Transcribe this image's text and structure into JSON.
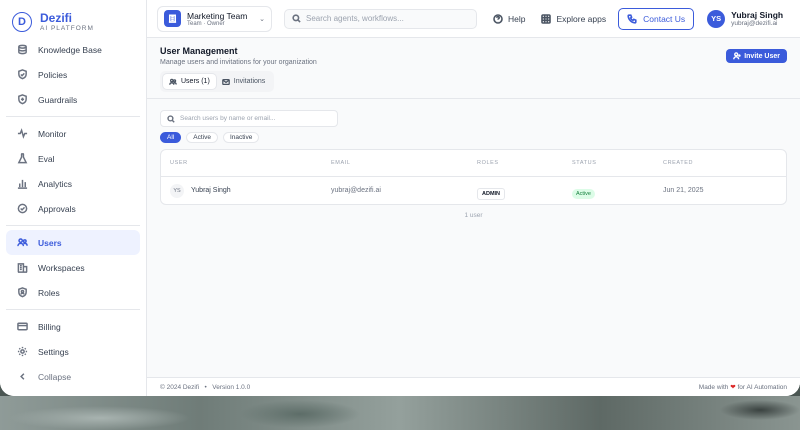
{
  "brand": {
    "name": "Dezifi",
    "subtitle": "AI PLATFORM",
    "logo_letter": "D"
  },
  "sidebar": {
    "items": [
      {
        "label": "Knowledge Base",
        "icon": "database-icon"
      },
      {
        "label": "Policies",
        "icon": "shield-check-icon"
      },
      {
        "label": "Guardrails",
        "icon": "shield-plus-icon"
      },
      {
        "label": "Monitor",
        "icon": "activity-icon"
      },
      {
        "label": "Eval",
        "icon": "flask-icon"
      },
      {
        "label": "Analytics",
        "icon": "bar-chart-icon"
      },
      {
        "label": "Approvals",
        "icon": "check-circle-icon"
      },
      {
        "label": "Users",
        "icon": "users-icon",
        "active": true
      },
      {
        "label": "Workspaces",
        "icon": "building-icon"
      },
      {
        "label": "Roles",
        "icon": "badge-icon"
      },
      {
        "label": "Billing",
        "icon": "credit-card-icon"
      },
      {
        "label": "Settings",
        "icon": "gear-icon"
      }
    ],
    "collapse_label": "Collapse"
  },
  "topbar": {
    "team_name": "Marketing Team",
    "team_role": "Team · Owner",
    "search_placeholder": "Search agents, workflows...",
    "help_label": "Help",
    "explore_label": "Explore apps",
    "contact_label": "Contact Us",
    "user_initials": "YS",
    "user_name": "Yubraj Singh",
    "user_email": "yubraj@dezifi.ai"
  },
  "page": {
    "title": "User Management",
    "subtitle": "Manage users and invitations for your organization",
    "invite_label": "Invite User",
    "tabs": [
      {
        "label": "Users (1)",
        "active": true
      },
      {
        "label": "Invitations"
      }
    ],
    "search_placeholder": "Search users by name or email...",
    "filters": [
      {
        "label": "All",
        "active": true
      },
      {
        "label": "Active"
      },
      {
        "label": "Inactive"
      }
    ],
    "columns": [
      "USER",
      "EMAIL",
      "ROLES",
      "STATUS",
      "CREATED"
    ],
    "rows": [
      {
        "initials": "YS",
        "name": "Yubraj Singh",
        "email": "yubraj@dezifi.ai",
        "role": "ADMIN",
        "status": "Active",
        "created": "Jun 21, 2025"
      }
    ],
    "count_label": "1 user"
  },
  "footer": {
    "copyright": "© 2024 Dezifi",
    "separator": "•",
    "version": "Version 1.0.0",
    "made_with": "Made with",
    "heart": "❤",
    "for_label": "for AI Automation"
  },
  "colors": {
    "accent": "#3b5bdb",
    "active_status_bg": "#dcfce7",
    "active_status_text": "#15803d"
  }
}
